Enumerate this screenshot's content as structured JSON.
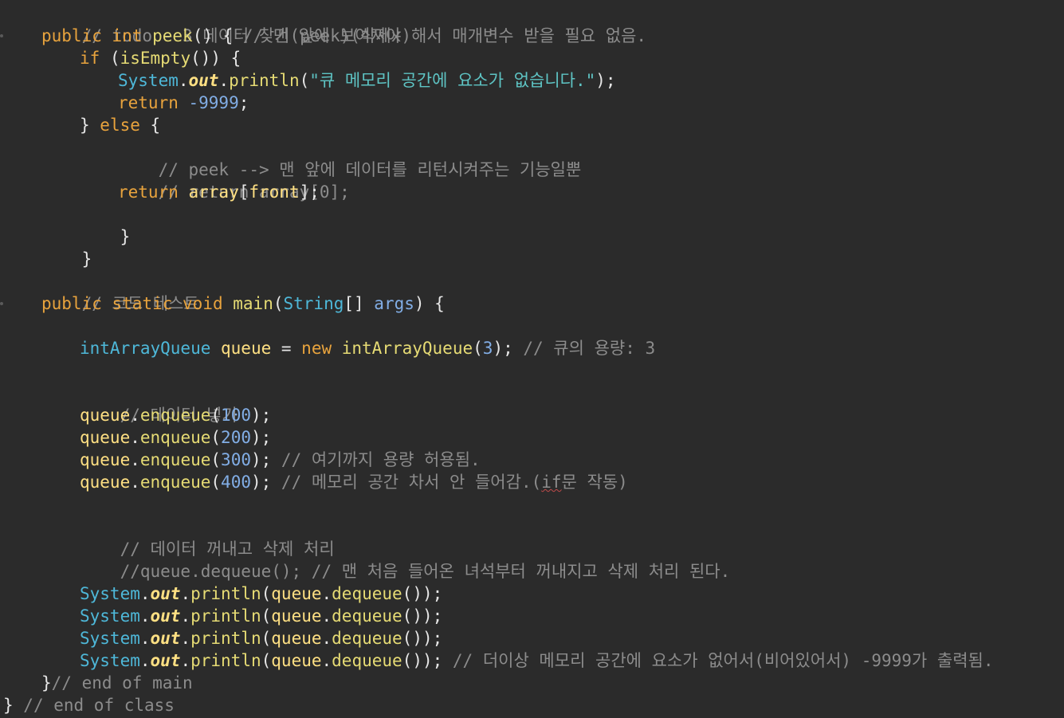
{
  "lines": {
    "l1_comment": "// todo - 3 데이터 찾기(peek)(삭제x)",
    "l2_public": "public",
    "l2_int": "int",
    "l2_peek": "peek",
    "l2_open": "() { ",
    "l2_comment": "// 맨 앞에 보여져야 해서 매개변수 받을 필요 없음.",
    "l3_if": "if",
    "l3_open": " (",
    "l3_isEmpty": "isEmpty",
    "l3_close": "()) {",
    "l4_system": "System",
    "l4_dot1": ".",
    "l4_out": "out",
    "l4_dot2": ".",
    "l4_println": "println",
    "l4_open": "(",
    "l4_string": "\"큐 메모리 공간에 요소가 없습니다.\"",
    "l4_close": ");",
    "l5_return": "return",
    "l5_value": " -9999",
    "l5_semi": ";",
    "l6_brace": "} ",
    "l6_else": "else",
    "l6_open": " {",
    "l7_comment": "// peek --> 맨 앞에 데이터를 리턴시켜주는 기능일뿐",
    "l8_comment": "// return array[0];",
    "l9_return": "return",
    "l9_array": " array",
    "l9_bracket1": "[",
    "l9_front": "front",
    "l9_bracket2": "];",
    "l10_brace": "}",
    "l11_brace": "}",
    "l13_comment": "// 코드 테스트",
    "l14_public": "public",
    "l14_static": "static",
    "l14_void": "void",
    "l14_main": "main",
    "l14_open": "(",
    "l14_String": "String",
    "l14_arr": "[] ",
    "l14_args": "args",
    "l14_close": ") {",
    "l16_type": "intArrayQueue",
    "l16_queue": " queue",
    "l16_eq": " = ",
    "l16_new": "new",
    "l16_ctor": " intArrayQueue",
    "l16_open": "(",
    "l16_num": "3",
    "l16_close": "); ",
    "l16_comment": "// 큐의 용량: 3",
    "l18_comment": "// 데이터 넣기",
    "queue": "queue",
    "dot": ".",
    "enqueue": "enqueue",
    "open": "(",
    "close_semi": ");",
    "l19_num": "100",
    "l20_num": "200",
    "l21_num": "300",
    "l21_comment": " // 여기까지 용량 허용됨.",
    "l22_num": "400",
    "l22_comment_a": " // 메모리 공간 차서 안 들어감.(",
    "l22_comment_if": "if",
    "l22_comment_b": "문 작동)",
    "l24_comment": "// 데이터 꺼내고 삭제 처리",
    "l25_comment": "//queue.dequeue(); // 맨 처음 들어온 녀석부터 꺼내지고 삭제 처리 된다.",
    "system": "System",
    "out": "out",
    "println": "println",
    "dequeue": "dequeue",
    "call_close": "());",
    "l29_comment": " // 더이상 메모리 공간에 요소가 없어서(비어있어서) -9999가 출력됨.",
    "l30_brace": "}",
    "l30_comment": "// end of main",
    "l31_brace": "}",
    "l31_comment": " // end of class"
  }
}
